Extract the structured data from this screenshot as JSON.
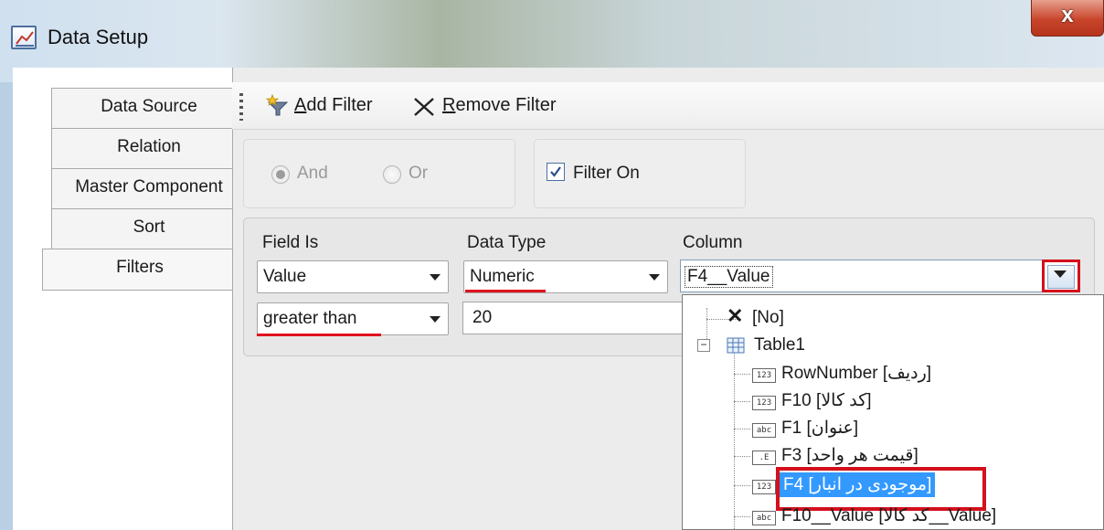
{
  "window": {
    "title": "Data Setup",
    "close_glyph": "x"
  },
  "tabs": [
    {
      "label": "Data Source"
    },
    {
      "label": "Relation"
    },
    {
      "label": "Master Component"
    },
    {
      "label": "Sort"
    },
    {
      "label": "Filters",
      "selected": true
    }
  ],
  "toolbar": {
    "add_filter_prefix": "",
    "add_filter_mnemonic": "A",
    "add_filter_rest": "dd Filter",
    "remove_filter_mnemonic": "R",
    "remove_filter_rest": "emove Filter"
  },
  "logic": {
    "and_label": "And",
    "or_label": "Or",
    "selected": "And",
    "enabled": false
  },
  "filter_on": {
    "label": "Filter On",
    "checked": true
  },
  "filter_row": {
    "field_is_header": "Field Is",
    "data_type_header": "Data Type",
    "column_header": "Column",
    "field_is_value": "Value",
    "data_type_value": "Numeric",
    "column_value": "F4__Value",
    "condition_value": "greater than",
    "value": "20"
  },
  "column_tree": {
    "items": [
      {
        "label": "[No]",
        "icon": "x-icon",
        "level": 0
      },
      {
        "label": "Table1",
        "icon": "table-icon",
        "level": 0,
        "expanded": true
      },
      {
        "label": "RowNumber [ردیف]",
        "badge": "123",
        "level": 1
      },
      {
        "label": "F10 [کد کالا]",
        "badge": "123",
        "level": 1
      },
      {
        "label": "F1 [عنوان]",
        "badge": "abc",
        "level": 1
      },
      {
        "label": "F3 [قیمت هر واحد]",
        "badge": ".E",
        "level": 1
      },
      {
        "label": "F4 [موجودی در انبار]",
        "badge": "123",
        "level": 1,
        "selected": true
      },
      {
        "label": "F10__Value [کد کالا__Value]",
        "badge": "abc",
        "level": 1
      }
    ]
  },
  "colors": {
    "highlight_red": "#d3101c",
    "selection_blue": "#3399ff"
  }
}
